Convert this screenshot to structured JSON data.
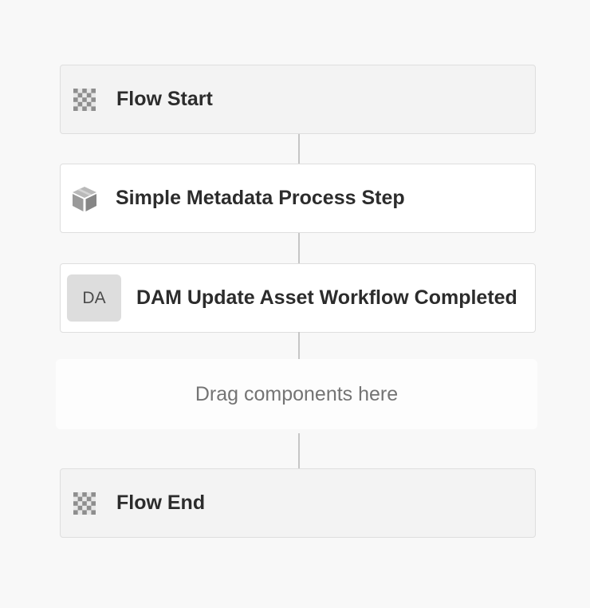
{
  "workflow": {
    "steps": [
      {
        "title": "Flow Start",
        "icon": "checkerboard-icon"
      },
      {
        "title": "Simple Metadata Process Step",
        "icon": "package-box-icon"
      },
      {
        "title": "DAM Update Asset Workflow Completed",
        "badge": "DA"
      },
      {
        "title": "Flow End",
        "icon": "checkerboard-icon"
      }
    ],
    "dropzone_label": "Drag components here"
  },
  "colors": {
    "canvas": "#f8f8f8",
    "marker_node_bg": "#f3f3f3",
    "step_node_bg": "#ffffff",
    "connector": "#c6c6c6",
    "badge_bg": "#dddddd"
  }
}
